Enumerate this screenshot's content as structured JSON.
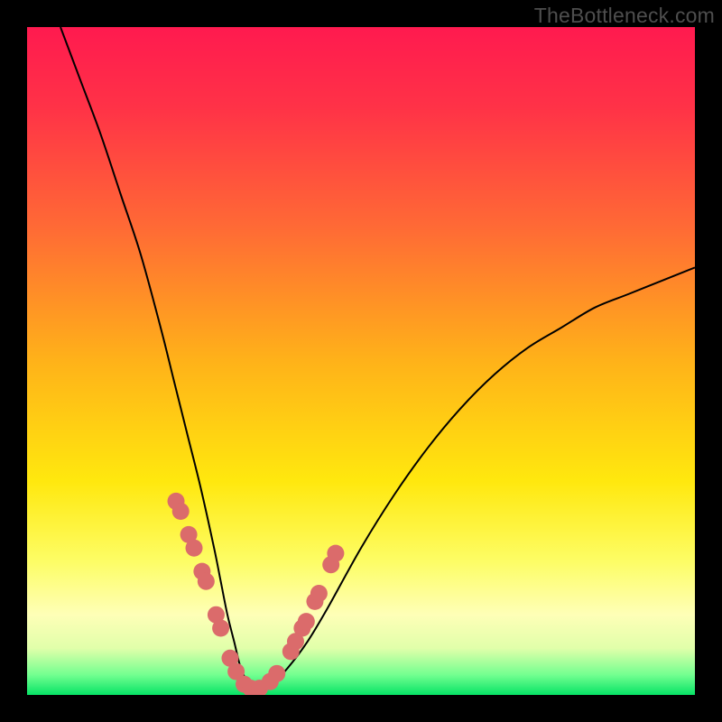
{
  "watermark": "TheBottleneck.com",
  "colors": {
    "frame": "#000000",
    "gradient_stops": [
      {
        "offset": 0.0,
        "color": "#ff1a4f"
      },
      {
        "offset": 0.12,
        "color": "#ff3247"
      },
      {
        "offset": 0.3,
        "color": "#ff6a35"
      },
      {
        "offset": 0.5,
        "color": "#ffb219"
      },
      {
        "offset": 0.68,
        "color": "#ffe80e"
      },
      {
        "offset": 0.8,
        "color": "#fdfd65"
      },
      {
        "offset": 0.88,
        "color": "#feffb7"
      },
      {
        "offset": 0.93,
        "color": "#e1ffaa"
      },
      {
        "offset": 0.97,
        "color": "#73ff90"
      },
      {
        "offset": 1.0,
        "color": "#07e366"
      }
    ],
    "curve_stroke": "#000000",
    "dot_fill": "#db6b6b"
  },
  "chart_data": {
    "type": "line",
    "title": "",
    "xlabel": "",
    "ylabel": "",
    "xlim": [
      0,
      100
    ],
    "ylim": [
      0,
      100
    ],
    "grid": false,
    "legend": false,
    "series": [
      {
        "name": "bottleneck-curve",
        "x": [
          5,
          8,
          11,
          14,
          17,
          20,
          22,
          24,
          26,
          28,
          29,
          30,
          31,
          32,
          33,
          34,
          35,
          37,
          39,
          42,
          45,
          50,
          55,
          60,
          65,
          70,
          75,
          80,
          85,
          90,
          95,
          100
        ],
        "values": [
          100,
          92,
          84,
          75,
          66,
          55,
          47,
          39,
          31,
          22,
          17,
          12,
          8,
          4,
          2,
          1,
          1,
          2,
          4,
          8,
          13,
          22,
          30,
          37,
          43,
          48,
          52,
          55,
          58,
          60,
          62,
          64
        ]
      }
    ],
    "overlay_dots": {
      "name": "highlighted-points",
      "x": [
        22.3,
        23.0,
        24.2,
        25.0,
        26.2,
        26.8,
        28.3,
        29.0,
        30.4,
        31.3,
        32.5,
        33.5,
        34.8,
        36.4,
        37.4,
        39.5,
        40.2,
        41.2,
        41.8,
        43.1,
        43.7,
        45.5,
        46.2
      ],
      "values": [
        29.0,
        27.5,
        24.0,
        22.0,
        18.5,
        17.0,
        12.0,
        10.0,
        5.5,
        3.5,
        1.6,
        1.0,
        1.0,
        2.0,
        3.2,
        6.5,
        8.0,
        10.0,
        11.0,
        14.0,
        15.2,
        19.5,
        21.2
      ]
    }
  }
}
